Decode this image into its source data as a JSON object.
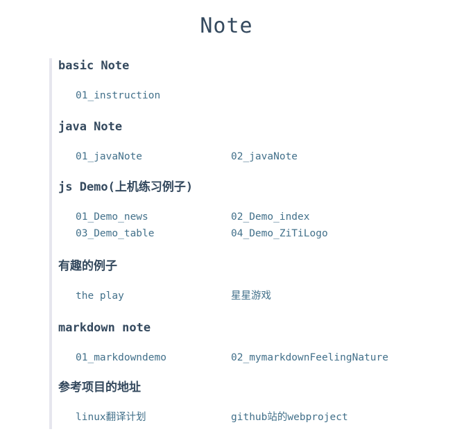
{
  "page": {
    "title": "Note"
  },
  "sections": [
    {
      "title": "basic Note",
      "links": [
        "01_instruction"
      ]
    },
    {
      "title": "java Note",
      "links": [
        "01_javaNote",
        "02_javaNote"
      ]
    },
    {
      "title": "js Demo(上机练习例子)",
      "links": [
        "01_Demo_news",
        "02_Demo_index",
        "03_Demo_table",
        "04_Demo_ZiTiLogo"
      ]
    },
    {
      "title": "有趣的例子",
      "links": [
        "the play",
        "星星游戏"
      ]
    },
    {
      "title": "markdown note",
      "links": [
        "01_markdowndemo",
        "02_mymarkdownFeelingNature"
      ]
    },
    {
      "title": "参考项目的地址",
      "links": [
        "linux翻译计划",
        "github站的webproject"
      ]
    }
  ],
  "colors": {
    "heading": "#34495e",
    "link": "#42708a",
    "border": "#e6e6ee",
    "background": "#ffffff"
  }
}
